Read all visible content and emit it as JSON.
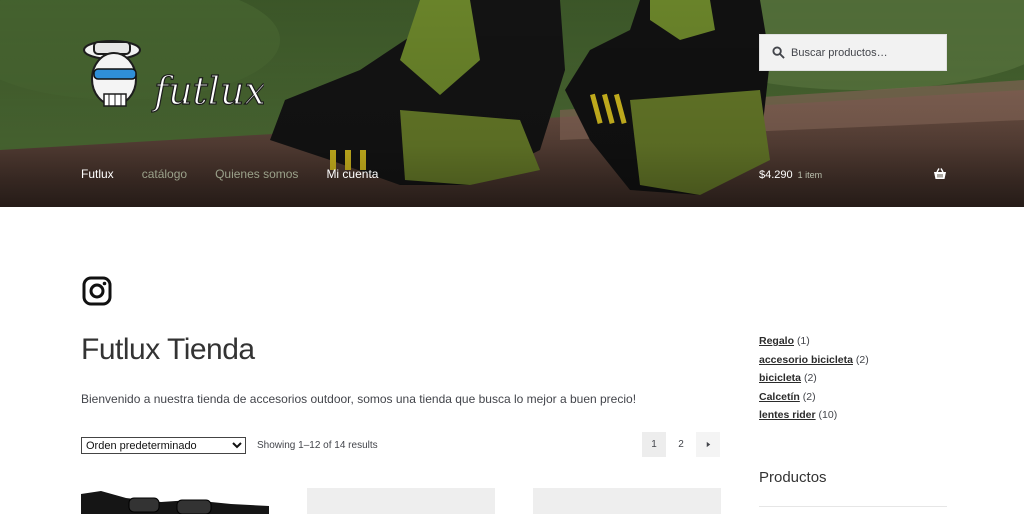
{
  "brand": {
    "name": "futlux"
  },
  "search": {
    "placeholder": "Buscar productos…"
  },
  "nav": {
    "items": [
      {
        "label": "Futlux"
      },
      {
        "label": "catálogo"
      },
      {
        "label": "Quienes somos"
      },
      {
        "label": "Mi cuenta"
      }
    ]
  },
  "cart": {
    "amount": "$4.290",
    "count": "1 item"
  },
  "main": {
    "title": "Futlux Tienda",
    "intro": "Bienvenido a nuestra tienda de accesorios outdoor, somos una tienda que busca lo mejor a buen precio!",
    "sort_selected": "Orden predeterminado",
    "result_count": "Showing 1–12 of 14 results",
    "pages": [
      "1",
      "2"
    ],
    "next_icon": "chevron-right-icon"
  },
  "sidebar": {
    "categories": [
      {
        "name": "Regalo",
        "count": "(1)"
      },
      {
        "name": "accesorio bicicleta",
        "count": "(2)"
      },
      {
        "name": "bicicleta",
        "count": "(2)"
      },
      {
        "name": "Calcetín",
        "count": "(2)"
      },
      {
        "name": "lentes rider",
        "count": "(10)"
      }
    ],
    "widget_title": "Productos"
  },
  "colors": {
    "text": "#43454b",
    "heading": "#333333",
    "header_green": "#4d6a33"
  }
}
